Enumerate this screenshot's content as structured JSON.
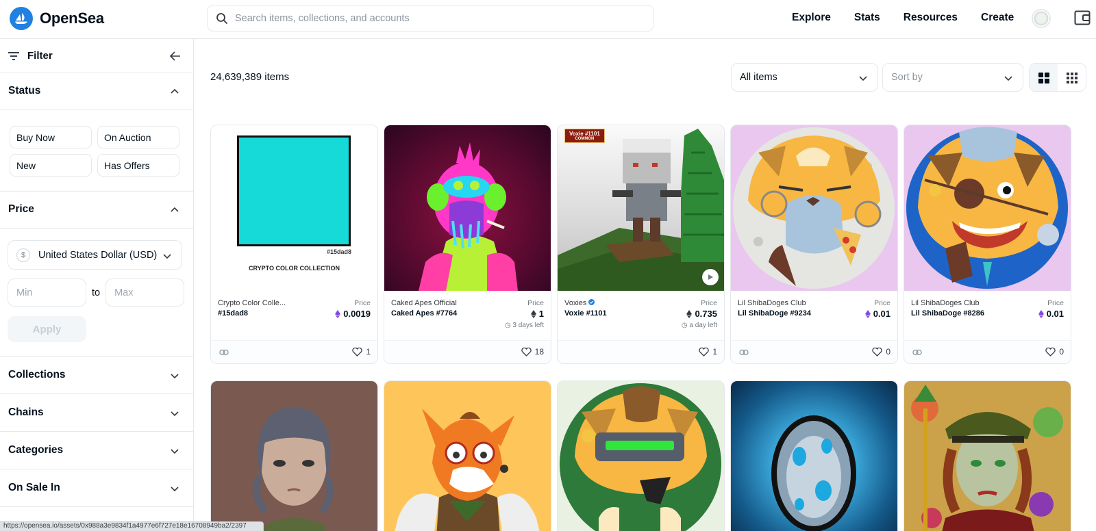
{
  "brand": {
    "name": "OpenSea",
    "color": "#2081e2"
  },
  "search": {
    "placeholder": "Search items, collections, and accounts"
  },
  "nav": [
    "Explore",
    "Stats",
    "Resources",
    "Create"
  ],
  "sidebar": {
    "filter_label": "Filter",
    "status": {
      "title": "Status",
      "options": [
        "Buy Now",
        "On Auction",
        "New",
        "Has Offers"
      ]
    },
    "price": {
      "title": "Price",
      "currency": "United States Dollar (USD)",
      "currency_symbol": "$",
      "min_placeholder": "Min",
      "to_label": "to",
      "max_placeholder": "Max",
      "apply_label": "Apply"
    },
    "sections": [
      "Collections",
      "Chains",
      "Categories",
      "On Sale In"
    ]
  },
  "main": {
    "item_count": "24,639,389 items",
    "filter_select": "All items",
    "sort_select": "Sort by"
  },
  "cards": [
    {
      "collection": "Crypto Color Colle...",
      "name": "#15dad8",
      "price_label": "Price",
      "price": "0.0019",
      "currency_icon": "polygon-eth-icon",
      "likes": "1",
      "image_text_code": "#15dad8",
      "image_text_title": "CRYPTO COLOR COLLECTION",
      "swatch": "#15dad8"
    },
    {
      "collection": "Caked Apes Official",
      "name": "Caked Apes #7764",
      "price_label": "Price",
      "price": "1",
      "currency_icon": "eth-icon",
      "time_left": "3 days left",
      "likes": "18"
    },
    {
      "collection": "Voxies",
      "verified": true,
      "name": "Voxie #1101",
      "price_label": "Price",
      "price": "0.735",
      "currency_icon": "eth-icon",
      "time_left": "a day left",
      "likes": "1",
      "image_badge": "Voxie #1101",
      "image_badge_sub": "COMMON"
    },
    {
      "collection": "Lil ShibaDoges Club",
      "name": "Lil ShibaDoge #9234",
      "price_label": "Price",
      "price": "0.01",
      "currency_icon": "polygon-eth-icon",
      "likes": "0"
    },
    {
      "collection": "Lil ShibaDoges Club",
      "name": "Lil ShibaDoge #8286",
      "price_label": "Price",
      "price": "0.01",
      "currency_icon": "polygon-eth-icon",
      "likes": "0"
    }
  ],
  "status_url": "https://opensea.io/assets/0x988a3e9834f1a4977e6f727e18e16708949ba2/2397"
}
